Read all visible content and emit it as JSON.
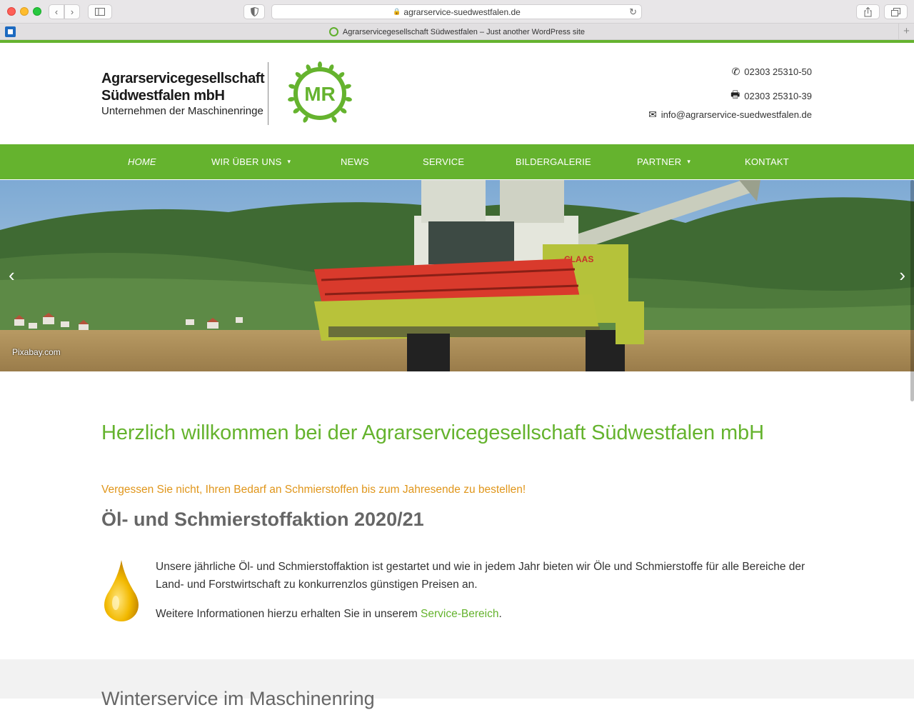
{
  "browser": {
    "url": "agrarservice-suedwestfalen.de",
    "tab_title": "Agrarservicegesellschaft Südwestfalen – Just another WordPress site"
  },
  "header": {
    "logo_line1": "Agrarservicegesellschaft",
    "logo_line2": "Südwestfalen mbH",
    "logo_line3": "Unternehmen der Maschinenringe",
    "mr_logo_text": "MR",
    "phone": "02303 25310-50",
    "fax": "02303 25310-39",
    "email": "info@agrarservice-suedwestfalen.de"
  },
  "nav": {
    "items": [
      {
        "label": "HOME"
      },
      {
        "label": "WIR ÜBER UNS"
      },
      {
        "label": "NEWS"
      },
      {
        "label": "SERVICE"
      },
      {
        "label": "BILDERGALERIE"
      },
      {
        "label": "PARTNER"
      },
      {
        "label": "KONTAKT"
      }
    ]
  },
  "hero": {
    "credit": "Pixabay.com",
    "prev_icon": "chevron-left-icon",
    "next_icon": "chevron-right-icon"
  },
  "content": {
    "welcome": "Herzlich willkommen bei der Agrarservicegesellschaft Südwestfalen mbH",
    "reminder": "Vergessen Sie nicht, Ihren Bedarf an Schmierstoffen bis zum Jahresende zu bestellen!",
    "section_title": "Öl- und Schmierstoffaktion 2020/21",
    "para1": "Unsere jährliche Öl- und Schmierstoffaktion ist gestartet und wie in jedem Jahr bieten wir Öle und Schmierstoffe für alle Bereiche der Land- und Forstwirtschaft zu konkurrenzlos günstigen Preisen an.",
    "para2_prefix": "Weitere Informationen hierzu erhalten Sie in unserem ",
    "para2_link": "Service-Bereich",
    "para2_suffix": ".",
    "next_section_title": "Winterservice im Maschinenring"
  },
  "colors": {
    "brand_green": "#65b32e",
    "accent_orange": "#e0961b"
  }
}
